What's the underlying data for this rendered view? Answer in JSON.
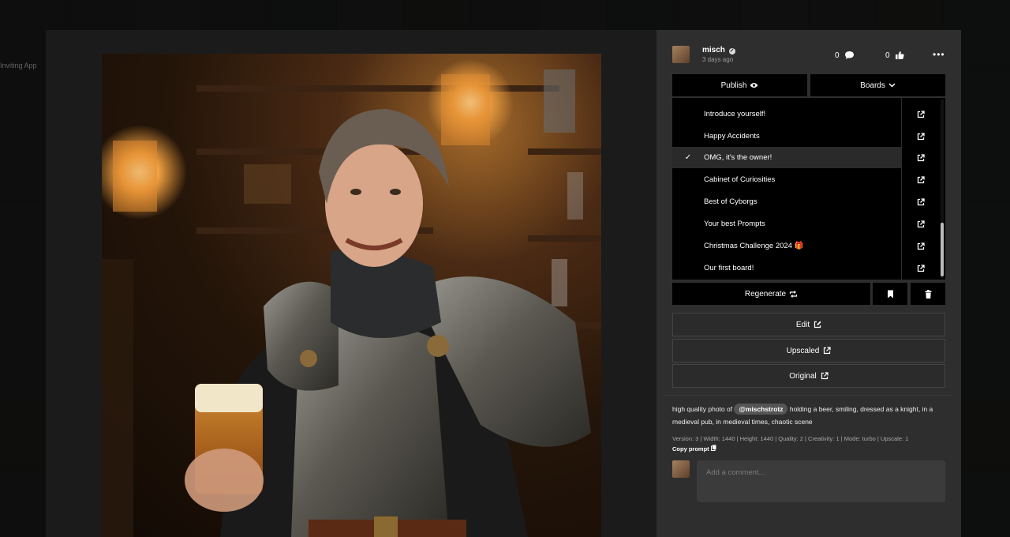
{
  "background": {
    "side_text": "Inviting App"
  },
  "post": {
    "username": "misch",
    "time_ago": "3 days ago",
    "comment_count": "0",
    "like_count": "0"
  },
  "actions": {
    "publish_label": "Publish",
    "boards_label": "Boards",
    "regenerate_label": "Regenerate",
    "edit_label": "Edit",
    "upscaled_label": "Upscaled",
    "original_label": "Original"
  },
  "boards": [
    {
      "label": "Introduce yourself!",
      "checked": false
    },
    {
      "label": "Happy Accidents",
      "checked": false
    },
    {
      "label": "OMG, it's the owner!",
      "checked": true
    },
    {
      "label": "Cabinet of Curiosities",
      "checked": false
    },
    {
      "label": "Best of Cyborgs",
      "checked": false
    },
    {
      "label": "Your best Prompts",
      "checked": false
    },
    {
      "label": "Christmas Challenge 2024 🎁",
      "checked": false
    },
    {
      "label": "Our first board!",
      "checked": false
    }
  ],
  "prompt": {
    "before": "high quality photo of",
    "mention": "@mischstrotz",
    "after": "holding a beer, smiling, dressed as a knight, in a medieval pub, in medieval times, chaotic scene",
    "meta": "Version: 3 | Width: 1440 | Height: 1440 | Quality: 2 | Creativity: 1 | Mode: turbo | Upscale: 1",
    "copy_label": "Copy prompt"
  },
  "comment": {
    "placeholder": "Add a comment..."
  },
  "colors": {
    "panel": "#2e2e2e",
    "dark_button": "#000000",
    "selected_row": "#2a2a2a"
  }
}
